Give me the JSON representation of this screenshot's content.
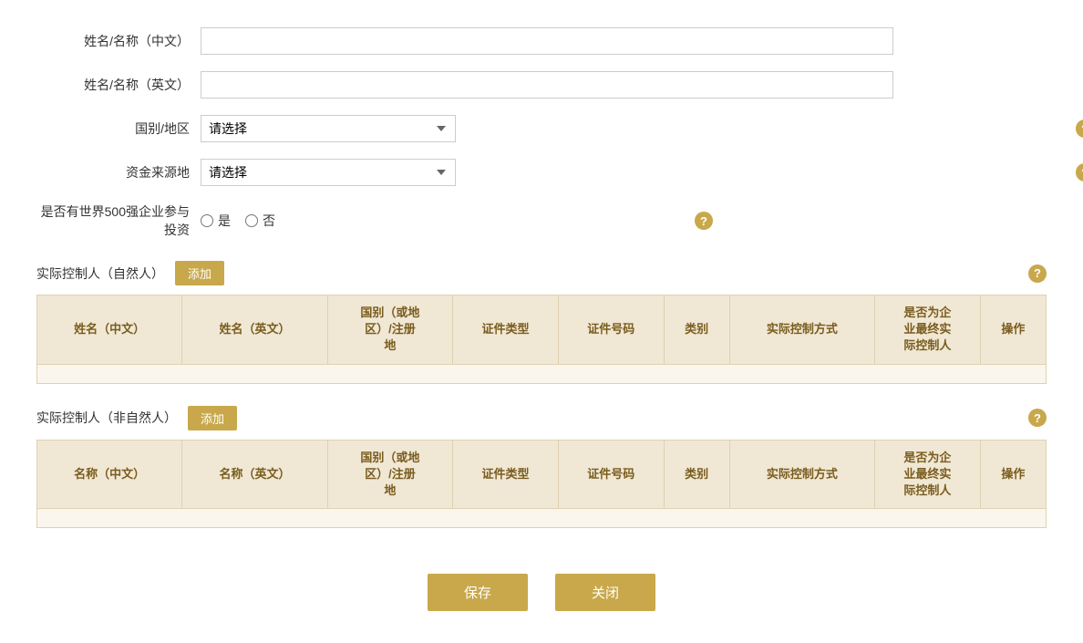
{
  "form": {
    "name_cn_label": "姓名/名称（中文）",
    "name_en_label": "姓名/名称（英文）",
    "country_label": "国别/地区",
    "fund_source_label": "资金来源地",
    "fortune500_label": "是否有世界500强企业参与投资",
    "select_placeholder": "请选择",
    "radio_yes": "是",
    "radio_no": "否"
  },
  "section1": {
    "title": "实际控制人（自然人）",
    "add_label": "添加",
    "columns": [
      "姓名（中文）",
      "姓名（英文）",
      "国别（或地\n区）/注册\n地",
      "证件类型",
      "证件号码",
      "类别",
      "实际控制方式",
      "是否为企\n业最终实\n际控制人",
      "操作"
    ]
  },
  "section2": {
    "title": "实际控制人（非自然人）",
    "add_label": "添加",
    "columns": [
      "名称（中文）",
      "名称（英文）",
      "国别（或地\n区）/注册\n地",
      "证件类型",
      "证件号码",
      "类别",
      "实际控制方式",
      "是否为企\n业最终实\n际控制人",
      "操作"
    ]
  },
  "buttons": {
    "save": "保存",
    "close": "关闭"
  },
  "help_icon": "?"
}
